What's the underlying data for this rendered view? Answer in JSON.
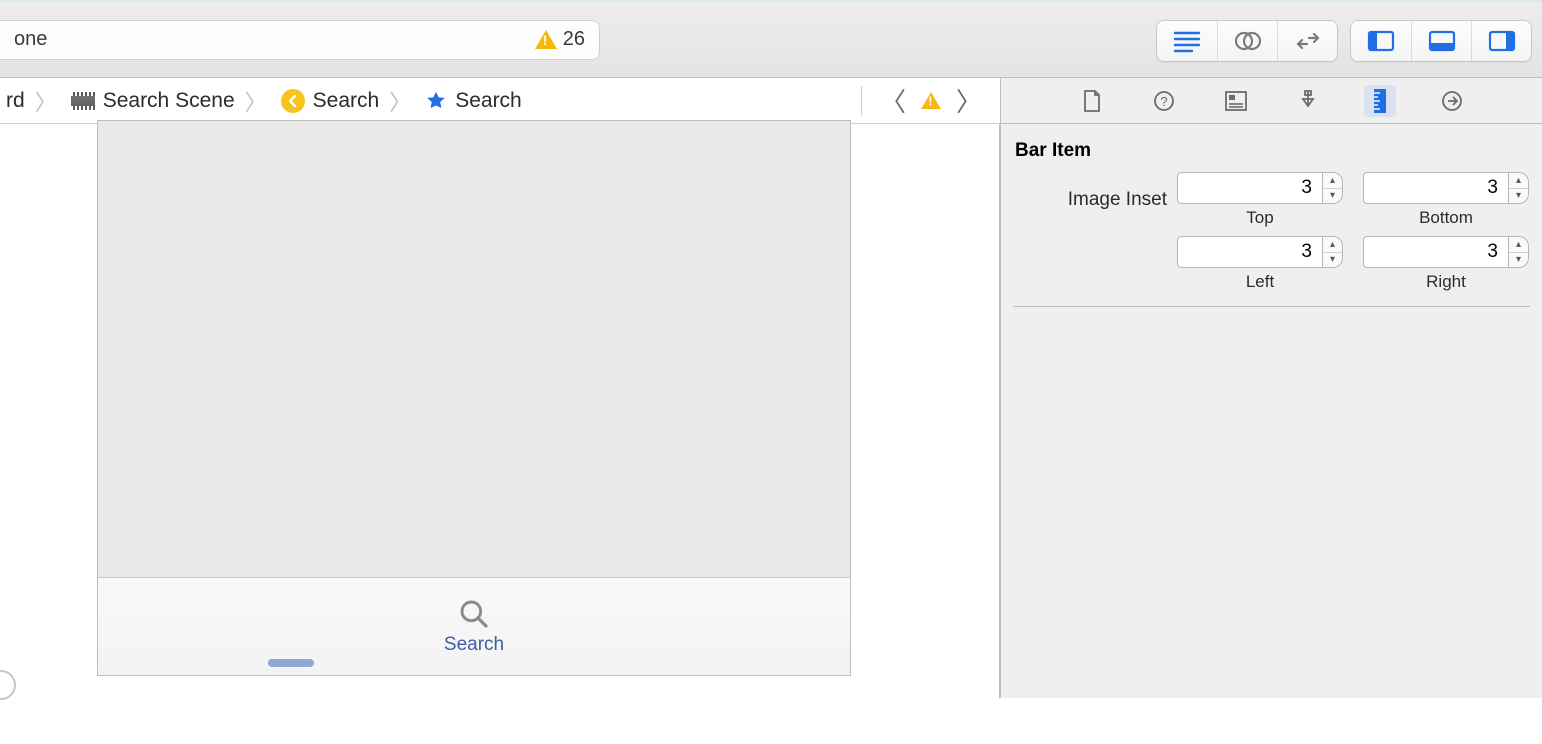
{
  "toolbar": {
    "device_text": "one",
    "issue_count": "26"
  },
  "breadcrumb": {
    "item0": "rd",
    "item1": "Search Scene",
    "item2": "Search",
    "item3": "Search"
  },
  "tabbar": {
    "item0_label": "Search"
  },
  "inspector": {
    "section_title": "Bar Item",
    "image_inset_label": "Image Inset",
    "top_value": "3",
    "top_label": "Top",
    "bottom_value": "3",
    "bottom_label": "Bottom",
    "left_value": "3",
    "left_label": "Left",
    "right_value": "3",
    "right_label": "Right"
  }
}
